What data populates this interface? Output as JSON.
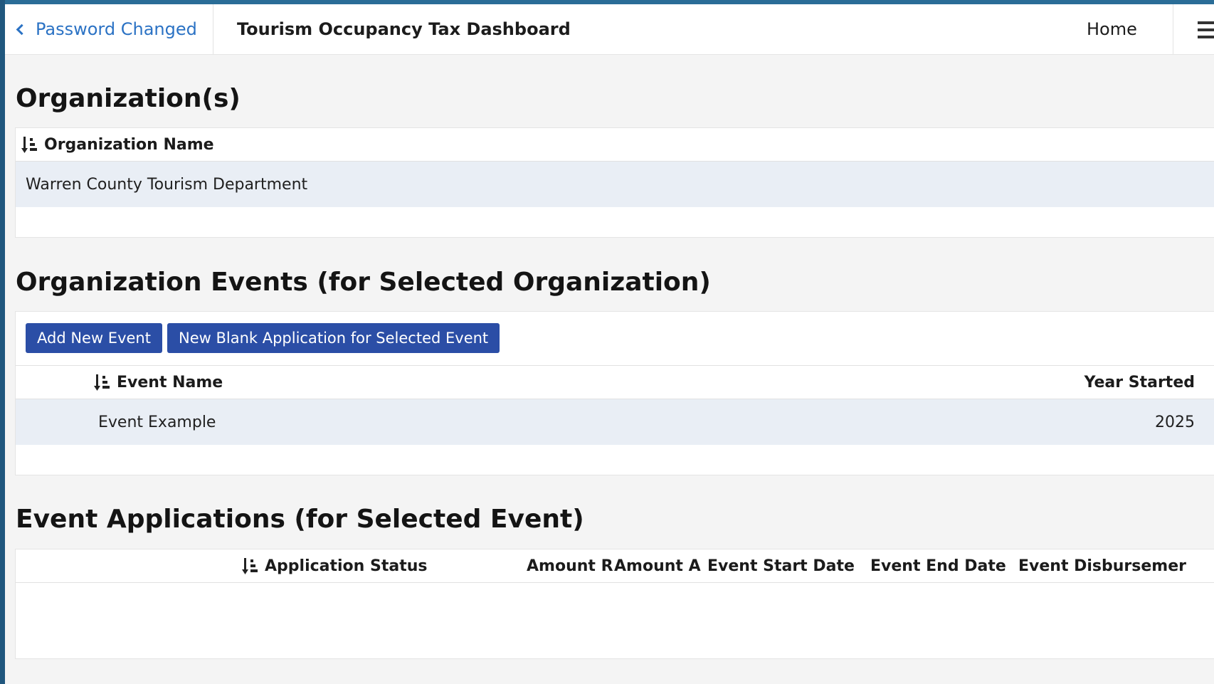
{
  "navbar": {
    "back_label": "Password Changed",
    "title": "Tourism Occupancy Tax Dashboard",
    "home_label": "Home"
  },
  "organizations": {
    "heading": "Organization(s)",
    "columns": [
      "Organization Name"
    ],
    "rows": [
      [
        "Warren County Tourism Department"
      ]
    ]
  },
  "events": {
    "heading": "Organization Events (for Selected Organization)",
    "buttons": {
      "add_new_event": "Add New Event",
      "new_blank_application": "New Blank Application for Selected Event"
    },
    "columns": [
      "Event Name",
      "Year Started"
    ],
    "rows": [
      [
        "Event Example",
        "2025"
      ]
    ]
  },
  "applications": {
    "heading": "Event Applications (for Selected Event)",
    "columns": [
      "Application Status",
      "Amount R",
      "Amount A",
      "Event Start Date",
      "Event End Date",
      "Event Disbursemer"
    ],
    "rows": []
  },
  "colors": {
    "accent_blue": "#2b4ea6",
    "link_blue": "#2b72c4",
    "frame_blue": "#20577e",
    "selected_row": "#e9eef5"
  },
  "icons": {
    "back": "chevron-left-icon",
    "sort": "sort-ascending-icon",
    "menu": "hamburger-menu-icon"
  }
}
